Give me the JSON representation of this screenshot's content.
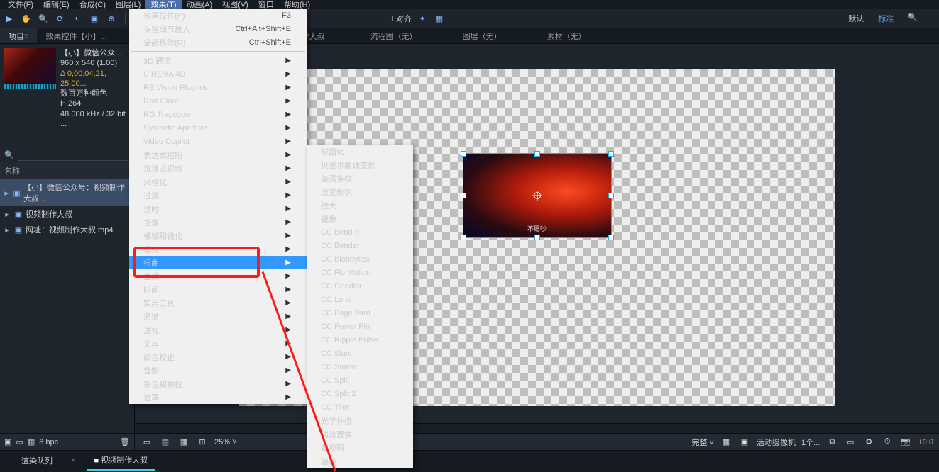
{
  "menubar": [
    "文件(F)",
    "编辑(E)",
    "合成(C)",
    "图层(L)",
    "效果(T)",
    "动画(A)",
    "视图(V)",
    "窗口",
    "帮助(H)"
  ],
  "menubar_active_index": 4,
  "toolbar": {
    "snap_label": "对齐",
    "preset_default": "默认",
    "preset_standard": "标准"
  },
  "panel_row": {
    "project": "项目",
    "effect_controls": "效果控件【小】..."
  },
  "viewer_tabs": [
    "作大叔",
    "流程图（无）",
    "图层（无）",
    "素材（无）"
  ],
  "project_item": {
    "title": "【小】微信公众...",
    "dims": "960 x 540 (1.00)",
    "dur": "Δ 0;00;04;21, 25.00...",
    "colors": "数百万种颜色",
    "codec": "H.264",
    "audio": "48.000 kHz / 32 bit ..."
  },
  "tree_header": "名称",
  "tree": [
    {
      "icon": "▶",
      "label": "【小】微信公众号：视频制作大叔...",
      "sel": true
    },
    {
      "icon": "▶",
      "label": "视频制作大叔",
      "sel": false
    },
    {
      "icon": "▶",
      "label": "网址：视频制作大叔.mp4",
      "sel": false
    }
  ],
  "subtitle": "不愿吵",
  "proj_btns": {
    "bpc": "8 bpc"
  },
  "viewer_status": {
    "zoom": "25%",
    "quality": "完整",
    "camera": "活动摄像机",
    "views": "1个...",
    "offset": "+0.0"
  },
  "timeline": {
    "tab1": "渲染队列",
    "tab2": "视频制作大叔"
  },
  "effects_menu": [
    {
      "label": "效果控件(E)",
      "shortcut": "F3"
    },
    {
      "label": "保留细节放大",
      "shortcut": "Ctrl+Alt+Shift+E"
    },
    {
      "label": "全部移除(R)",
      "shortcut": "Ctrl+Shift+E"
    },
    {
      "sep": true
    },
    {
      "label": "3D 通道",
      "sub": true
    },
    {
      "label": "CINEMA 4D",
      "sub": true
    },
    {
      "label": "RE:Vision Plug-ins",
      "sub": true
    },
    {
      "label": "Red Giant",
      "sub": true
    },
    {
      "label": "RG Trapcode",
      "sub": true
    },
    {
      "label": "Synthetic Aperture",
      "sub": true
    },
    {
      "label": "Video Copilot",
      "sub": true
    },
    {
      "label": "表达式控制",
      "sub": true
    },
    {
      "label": "沉浸式视频",
      "sub": true
    },
    {
      "label": "风格化",
      "sub": true
    },
    {
      "label": "过渡",
      "sub": true
    },
    {
      "label": "过时",
      "sub": true
    },
    {
      "label": "抠像",
      "sub": true
    },
    {
      "label": "模糊和锐化",
      "sub": true
    },
    {
      "label": "模拟",
      "sub": true
    },
    {
      "label": "扭曲",
      "sub": true,
      "hl": true
    },
    {
      "label": "生成",
      "sub": true
    },
    {
      "label": "时间",
      "sub": true
    },
    {
      "label": "实用工具",
      "sub": true
    },
    {
      "label": "通道",
      "sub": true
    },
    {
      "label": "透视",
      "sub": true
    },
    {
      "label": "文本",
      "sub": true
    },
    {
      "label": "颜色校正",
      "sub": true
    },
    {
      "label": "音频",
      "sub": true
    },
    {
      "label": "杂色和颗粒",
      "sub": true
    },
    {
      "label": "遮罩",
      "sub": true
    }
  ],
  "distort_menu": [
    "球面化",
    "贝塞尔曲线变形",
    "漩涡条纹",
    "改变形状",
    "放大",
    "镜像",
    "CC Bend It",
    "CC Bender",
    "CC Blobbylize",
    "CC Flo Motion",
    "CC Griddler",
    "CC Lens",
    "CC Page Turn",
    "CC Power Pin",
    "CC Ripple Pulse",
    "CC Slant",
    "CC Smear",
    "CC Split",
    "CC Split 2",
    "CC Tiler",
    "光学补偿",
    "湍流置换",
    "置换图",
    "偏移"
  ]
}
